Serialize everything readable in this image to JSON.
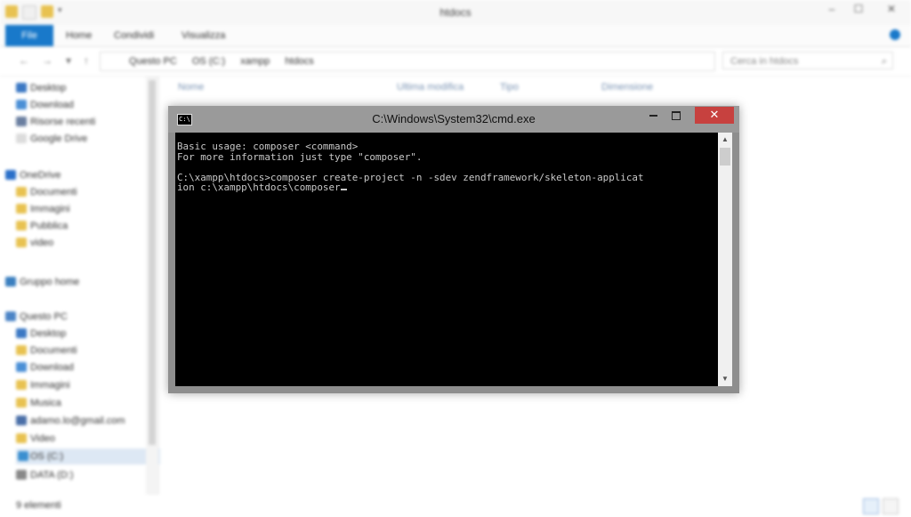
{
  "explorer": {
    "title": "htdocs",
    "ribbon_tabs": [
      "File",
      "Home",
      "Condividi",
      "Visualizza"
    ],
    "breadcrumb": [
      "Questo PC",
      "OS (C:)",
      "xampp",
      "htdocs"
    ],
    "search_placeholder": "Cerca in htdocs",
    "columns": [
      "Nome",
      "Ultima modifica",
      "Tipo",
      "Dimensione"
    ],
    "nav_items": [
      "Desktop",
      "Download",
      "Risorse recenti",
      "Google Drive",
      "OneDrive",
      "Documenti",
      "Immagini",
      "Pubblica",
      "video",
      "Gruppo home",
      "Questo PC",
      "Desktop",
      "Documenti",
      "Download",
      "Immagini",
      "Musica",
      "adamo.lo@gmail.com",
      "Video",
      "OS (C:)",
      "DATA (D:)"
    ],
    "status_text": "9 elementi"
  },
  "cmd": {
    "title": "C:\\Windows\\System32\\cmd.exe",
    "icon_label": "C:\\",
    "close_label": "✕",
    "lines": [
      "Basic usage: composer <command>",
      "For more information just type \"composer\".",
      "",
      "C:\\xampp\\htdocs>composer create-project -n -sdev zendframework/skeleton-applicat",
      "ion c:\\xampp\\htdocs\\composer"
    ]
  },
  "colors": {
    "file_tab": "#1979ca",
    "close_button": "#c7413f",
    "console_bg": "#000000",
    "console_fg": "#c8c8c8"
  }
}
